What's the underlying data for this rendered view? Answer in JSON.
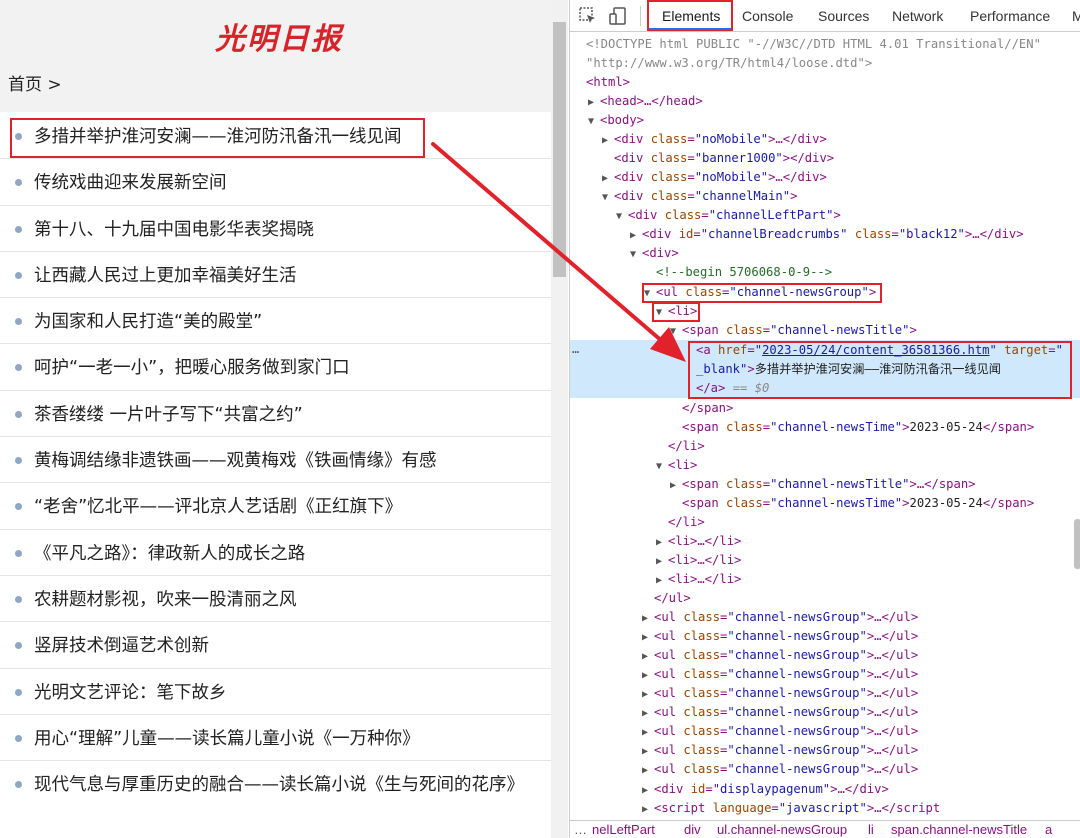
{
  "left_page": {
    "logo": "光明日报",
    "breadcrumb": "首页  >",
    "news": [
      "多措并举护淮河安澜——淮河防汛备汛一线见闻",
      "传统戏曲迎来发展新空间",
      "第十八、十九届中国电影华表奖揭晓",
      "让西藏人民过上更加幸福美好生活",
      "为国家和人民打造“美的殿堂”",
      "呵护“一老一小”，把暖心服务做到家门口",
      "茶香缕缕 一片叶子写下“共富之约”",
      "黄梅调结缘非遗铁画——观黄梅戏《铁画情缘》有感",
      "“老舍”忆北平——评北京人艺话剧《正红旗下》",
      "《平凡之路》：律政新人的成长之路",
      "农耕题材影视，吹来一股清丽之风",
      "竖屏技术倒逼艺术创新",
      "光明文艺评论：笔下故乡",
      "用心“理解”儿童——读长篇儿童小说《一万种你》",
      "现代气息与厚重历史的融合——读长篇小说《生与死间的花序》"
    ]
  },
  "devtools": {
    "tabs": [
      "Elements",
      "Console",
      "Sources",
      "Network",
      "Performance",
      "M"
    ],
    "active_tab": "Elements",
    "doctype_1": "<!DOCTYPE html PUBLIC \"-//W3C//DTD HTML 4.01 Transitional//EN\"",
    "doctype_2": "\"http://www.w3.org/TR/html4/loose.dtd\">",
    "html_tag": "<html>",
    "head_tag": "<head>…</head>",
    "body_tag": "<body>",
    "div_tag": "<div ",
    "class_attr": "class",
    "id_attr": "id",
    "eq": "=",
    "ellipsis_div_close": ">…</div>",
    "div_close": "></div>",
    "gt": ">",
    "nomobile_val": "\"noMobile\"",
    "banner_val": "\"banner1000\"",
    "channelmain_val": "\"channelMain\"",
    "leftpart_val": "\"channelLeftPart\"",
    "breadcrumbs_id_val": "\"channelBreadcrumbs\"",
    "black12_val": "\"black12\"",
    "plain_div": "<div>",
    "comment": "<!--begin 5706068-0-9-->",
    "ul_open": "<ul ",
    "newsgroup_val": "\"channel-newsGroup\"",
    "li_open": "<li>",
    "span_open": "<span ",
    "newstitle_val": "\"channel-newsTitle\"",
    "newstime_val": "\"channel-newsTime\"",
    "a_open": "<a ",
    "href_attr": "href",
    "href_val": "2023-05/24/content_36581366.htm",
    "target_attr": "target",
    "target_val_1": "\"",
    "target_val_2": "_blank\"",
    "a_text": "多措并举护淮河安澜——淮河防汛备汛一线见闻",
    "a_close": "</a>",
    "eq_dollar": " == $0",
    "span_close": "</span>",
    "date": "2023-05-24",
    "li_close": "</li>",
    "li_collapsed": "<li>…</li>",
    "ul_close": "</ul>",
    "span_collapsed": ">…</span>",
    "ul_collapsed": ">…</ul>",
    "displaypagenum_val": "\"displaypagenum\"",
    "script_open": "<script ",
    "language_attr": "language",
    "javascript_val": "\"javascript\"",
    "script_collapsed": ">…</script",
    "sel_dots": "…",
    "crumbs": [
      "…",
      "nelLeftPart",
      "div",
      "ul.channel-newsGroup",
      "li",
      "span.channel-newsTitle",
      "a"
    ]
  }
}
